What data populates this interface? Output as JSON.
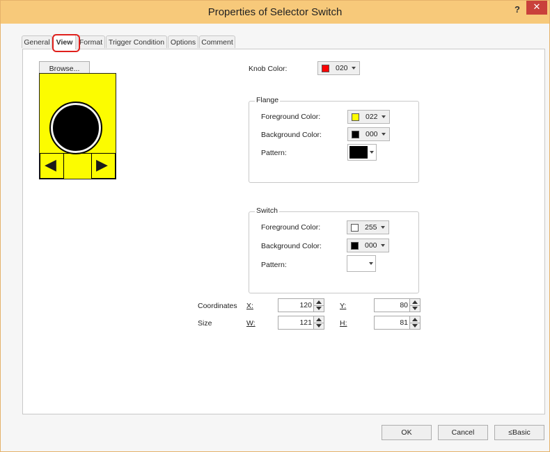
{
  "window": {
    "title": "Properties of Selector Switch",
    "help_label": "?",
    "close_label": "✕"
  },
  "tabs": [
    {
      "label": "General"
    },
    {
      "label": "View",
      "active": true
    },
    {
      "label": "Format"
    },
    {
      "label": "Trigger Condition"
    },
    {
      "label": "Options"
    },
    {
      "label": "Comment"
    }
  ],
  "view": {
    "browse_label": "Browse...",
    "knob_color": {
      "label": "Knob Color:",
      "code": "020",
      "swatch": "#ff0000"
    },
    "flange": {
      "title": "Flange",
      "foreground": {
        "label": "Foreground Color:",
        "code": "022",
        "swatch": "#ffff00"
      },
      "background": {
        "label": "Background Color:",
        "code": "000",
        "swatch": "#000000"
      },
      "pattern": {
        "label": "Pattern:",
        "fill": "#000000"
      }
    },
    "switch": {
      "title": "Switch",
      "foreground": {
        "label": "Foreground Color:",
        "code": "255",
        "swatch": "#ffffff"
      },
      "background": {
        "label": "Background Color:",
        "code": "000",
        "swatch": "#000000"
      },
      "pattern": {
        "label": "Pattern:",
        "fill": "#ffffff"
      }
    },
    "coordinates": {
      "label": "Coordinates",
      "x_label": "X:",
      "x_value": "120",
      "y_label": "Y:",
      "y_value": "80"
    },
    "size": {
      "label": "Size",
      "w_label": "W:",
      "w_value": "121",
      "h_label": "H:",
      "h_value": "81"
    }
  },
  "preview": {
    "background": "#fcfc00",
    "knob_color": "#000000",
    "left_arrow": "◀",
    "right_arrow": "▶"
  },
  "footer": {
    "ok_label": "OK",
    "cancel_label": "Cancel",
    "basic_label": "≤Basic"
  }
}
